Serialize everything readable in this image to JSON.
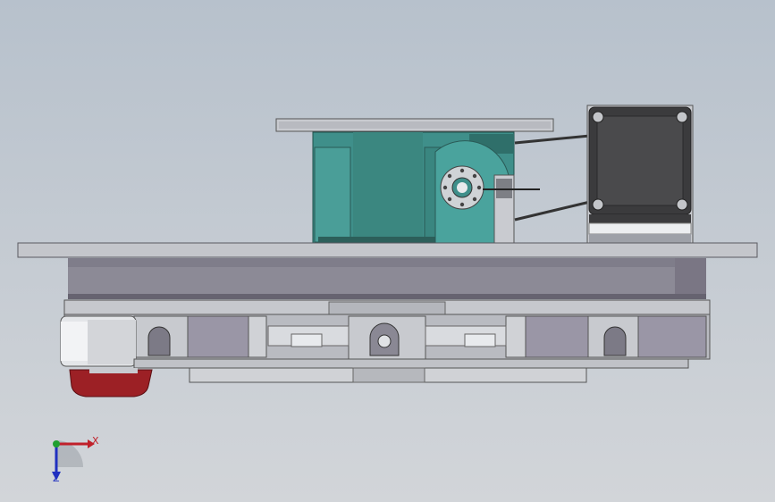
{
  "viewport": {
    "background_top": "#b7c1cc",
    "background_bottom": "#d2d5d9"
  },
  "model": {
    "part_colors": {
      "gearbox": "#3f8f8a",
      "gearbox_dark": "#2f6f6a",
      "motor_body": "#3b3b3d",
      "motor_face": "#4a4a4c",
      "plate": "#c4c6cb",
      "plate_edge": "#5a5a60",
      "bearing_ring": "#8c8a96",
      "rail_block": "#9a96a6",
      "bracket": "#d6d8dc",
      "red_handle": "#9c2025"
    }
  },
  "triad": {
    "x_label": "X",
    "z_label": "Z",
    "x_color": "#c0202a",
    "y_color": "#20a030",
    "z_color": "#2030c0"
  }
}
